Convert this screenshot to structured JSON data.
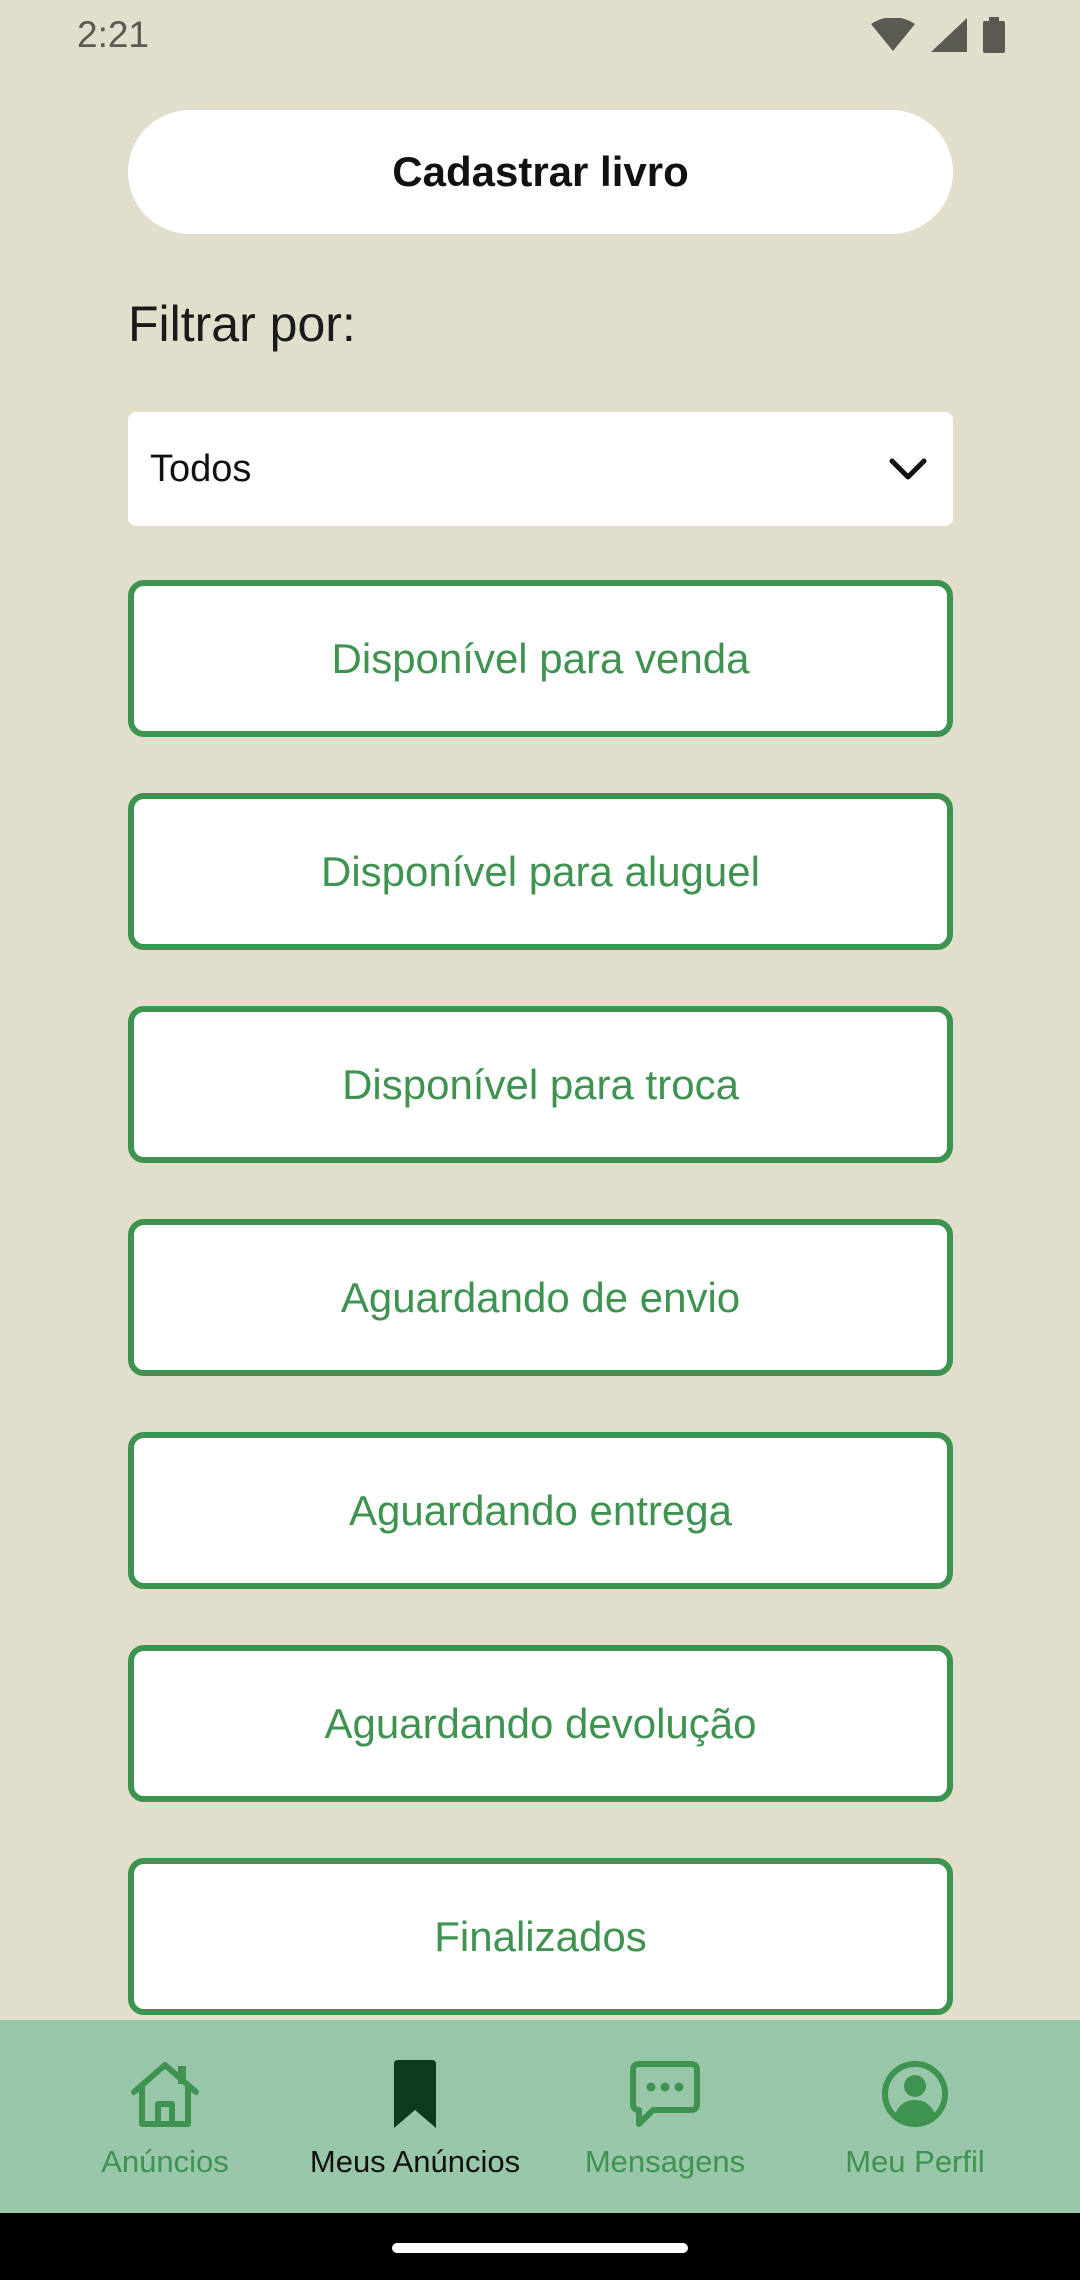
{
  "status_bar": {
    "time": "2:21"
  },
  "register_button": {
    "label": "Cadastrar livro"
  },
  "filter": {
    "label": "Filtrar por:",
    "selected": "Todos"
  },
  "status_options": [
    {
      "label": "Disponível para venda"
    },
    {
      "label": "Disponível para aluguel"
    },
    {
      "label": "Disponível para troca"
    },
    {
      "label": "Aguardando de envio"
    },
    {
      "label": "Aguardando entrega"
    },
    {
      "label": "Aguardando devolução"
    },
    {
      "label": "Finalizados"
    }
  ],
  "bottom_nav": {
    "items": [
      {
        "label": "Anúncios",
        "icon": "home-icon",
        "active": false
      },
      {
        "label": "Meus Anúncios",
        "icon": "bookmark-icon",
        "active": true
      },
      {
        "label": "Mensagens",
        "icon": "chat-icon",
        "active": false
      },
      {
        "label": "Meu Perfil",
        "icon": "profile-icon",
        "active": false
      }
    ]
  },
  "colors": {
    "background": "#e1decb",
    "accent_green": "#3f9350",
    "nav_background": "#98c6a9"
  }
}
